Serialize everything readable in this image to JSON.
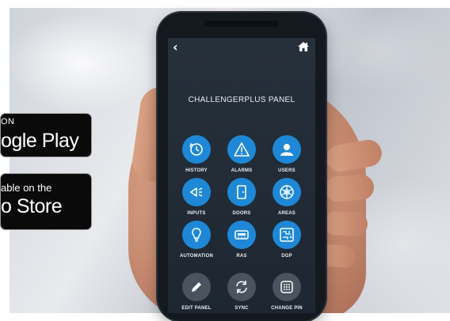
{
  "badges": {
    "google": {
      "line1": "ON",
      "line2": "ogle Play"
    },
    "apple": {
      "line1": "able on the",
      "line2": "o Store"
    }
  },
  "app": {
    "panel_title": "CHALLENGERPLUS PANEL",
    "back_glyph": "‹",
    "accent_color": "#1e88d6",
    "secondary_color": "#4a535e",
    "tiles": [
      {
        "label": "HISTORY",
        "icon": "history-icon"
      },
      {
        "label": "ALARMS",
        "icon": "warning-icon"
      },
      {
        "label": "USERS",
        "icon": "user-icon"
      },
      {
        "label": "INPUTS",
        "icon": "inputs-icon"
      },
      {
        "label": "DOORS",
        "icon": "door-icon"
      },
      {
        "label": "AREAS",
        "icon": "areas-icon"
      },
      {
        "label": "AUTOMATION",
        "icon": "lightbulb-icon"
      },
      {
        "label": "RAS",
        "icon": "keypad-device-icon"
      },
      {
        "label": "DGP",
        "icon": "circuit-board-icon"
      },
      {
        "label": "EDIT PANEL",
        "icon": "pencil-icon"
      },
      {
        "label": "SYNC",
        "icon": "sync-icon"
      },
      {
        "label": "CHANGE PIN",
        "icon": "pin-keypad-icon"
      }
    ]
  }
}
